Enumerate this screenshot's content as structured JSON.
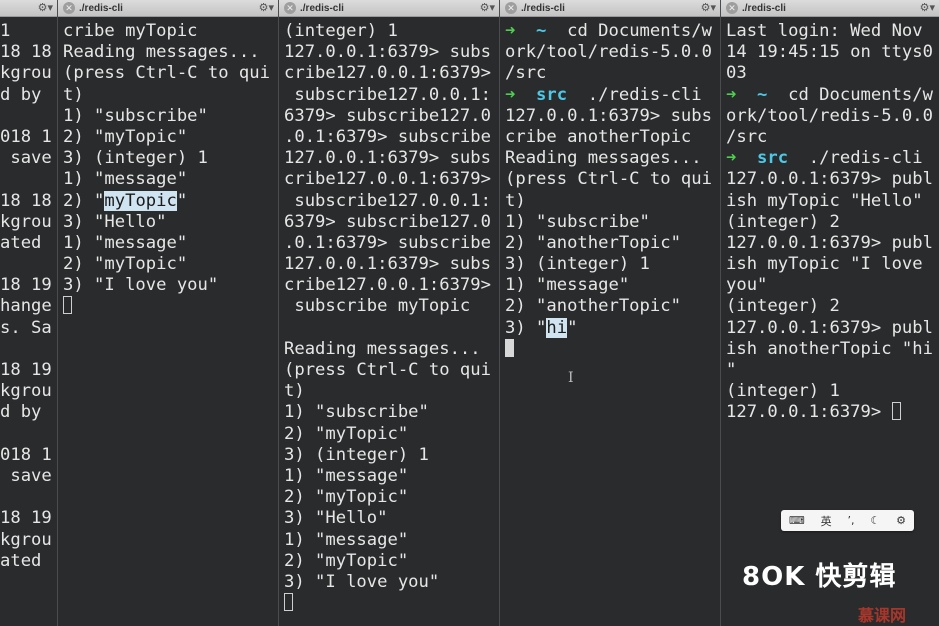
{
  "panes": [
    {
      "title": "",
      "lines": [
        [
          {
            "t": "1"
          }
        ],
        [
          {
            "t": "18 18"
          }
        ],
        [
          {
            "t": "kgrou"
          }
        ],
        [
          {
            "t": "d by"
          }
        ],
        [
          {
            "t": ""
          }
        ],
        [
          {
            "t": "018 1"
          }
        ],
        [
          {
            "t": " save"
          }
        ],
        [
          {
            "t": ""
          }
        ],
        [
          {
            "t": "18 18"
          }
        ],
        [
          {
            "t": "kgrou"
          }
        ],
        [
          {
            "t": "ated"
          }
        ],
        [
          {
            "t": ""
          }
        ],
        [
          {
            "t": "18 19"
          }
        ],
        [
          {
            "t": "hange"
          }
        ],
        [
          {
            "t": "s. Sa"
          }
        ],
        [
          {
            "t": ""
          }
        ],
        [
          {
            "t": "18 19"
          }
        ],
        [
          {
            "t": "kgrou"
          }
        ],
        [
          {
            "t": "d by"
          }
        ],
        [
          {
            "t": ""
          }
        ],
        [
          {
            "t": "018 1"
          }
        ],
        [
          {
            "t": " save"
          }
        ],
        [
          {
            "t": ""
          }
        ],
        [
          {
            "t": "18 19"
          }
        ],
        [
          {
            "t": "kgrou"
          }
        ],
        [
          {
            "t": "ated"
          }
        ]
      ]
    },
    {
      "title": "./redis-cli",
      "lines": [
        [
          {
            "t": "cribe myTopic"
          }
        ],
        [
          {
            "t": "Reading messages..."
          }
        ],
        [
          {
            "t": "(press Ctrl-C to qui"
          }
        ],
        [
          {
            "t": "t)"
          }
        ],
        [
          {
            "t": "1) \"subscribe\""
          }
        ],
        [
          {
            "t": "2) \"myTopic\""
          }
        ],
        [
          {
            "t": "3) (integer) 1"
          }
        ],
        [
          {
            "t": "1) \"message\""
          }
        ],
        [
          {
            "t": "2) \""
          },
          {
            "t": "myTopic",
            "c": "hl"
          },
          {
            "t": "\""
          }
        ],
        [
          {
            "t": "3) \"Hello\""
          }
        ],
        [
          {
            "t": "1) \"message\""
          }
        ],
        [
          {
            "t": "2) \"myTopic\""
          }
        ],
        [
          {
            "t": "3) \"I love you\""
          }
        ],
        [
          {
            "c": "cursor-box"
          }
        ]
      ]
    },
    {
      "title": "./redis-cli",
      "lines": [
        [
          {
            "t": "(integer) 1"
          }
        ],
        [
          {
            "t": "127.0.0.1:6379> subs"
          }
        ],
        [
          {
            "t": "cribe127.0.0.1:6379>"
          }
        ],
        [
          {
            "t": " subscribe127.0.0.1:"
          }
        ],
        [
          {
            "t": "6379> subscribe127.0"
          }
        ],
        [
          {
            "t": ".0.1:6379> subscribe"
          }
        ],
        [
          {
            "t": "127.0.0.1:6379> subs"
          }
        ],
        [
          {
            "t": "cribe127.0.0.1:6379>"
          }
        ],
        [
          {
            "t": " subscribe127.0.0.1:"
          }
        ],
        [
          {
            "t": "6379> subscribe127.0"
          }
        ],
        [
          {
            "t": ".0.1:6379> subscribe"
          }
        ],
        [
          {
            "t": "127.0.0.1:6379> subs"
          }
        ],
        [
          {
            "t": "cribe127.0.0.1:6379>"
          }
        ],
        [
          {
            "t": " subscribe myTopic"
          }
        ],
        [
          {
            "t": ""
          }
        ],
        [
          {
            "t": "Reading messages..."
          }
        ],
        [
          {
            "t": "(press Ctrl-C to qui"
          }
        ],
        [
          {
            "t": "t)"
          }
        ],
        [
          {
            "t": "1) \"subscribe\""
          }
        ],
        [
          {
            "t": "2) \"myTopic\""
          }
        ],
        [
          {
            "t": "3) (integer) 1"
          }
        ],
        [
          {
            "t": "1) \"message\""
          }
        ],
        [
          {
            "t": "2) \"myTopic\""
          }
        ],
        [
          {
            "t": "3) \"Hello\""
          }
        ],
        [
          {
            "t": "1) \"message\""
          }
        ],
        [
          {
            "t": "2) \"myTopic\""
          }
        ],
        [
          {
            "t": "3) \"I love you\""
          }
        ],
        [
          {
            "c": "cursor-box"
          }
        ]
      ]
    },
    {
      "title": "./redis-cli",
      "lines": [
        [
          {
            "t": "➜ ",
            "c": "arrow"
          },
          {
            "t": " ~  ",
            "c": "srcword"
          },
          {
            "t": "cd Documents/w"
          }
        ],
        [
          {
            "t": "ork/tool/redis-5.0.0"
          }
        ],
        [
          {
            "t": "/src"
          }
        ],
        [
          {
            "t": "➜ ",
            "c": "arrow"
          },
          {
            "t": " src  ",
            "c": "srcword"
          },
          {
            "t": "./redis-cli"
          }
        ],
        [
          {
            "t": "127.0.0.1:6379> subs"
          }
        ],
        [
          {
            "t": "cribe anotherTopic"
          }
        ],
        [
          {
            "t": "Reading messages..."
          }
        ],
        [
          {
            "t": "(press Ctrl-C to qui"
          }
        ],
        [
          {
            "t": "t)"
          }
        ],
        [
          {
            "t": "1) \"subscribe\""
          }
        ],
        [
          {
            "t": "2) \"anotherTopic\""
          }
        ],
        [
          {
            "t": "3) (integer) 1"
          }
        ],
        [
          {
            "t": "1) \"message\""
          }
        ],
        [
          {
            "t": "2) \"anotherTopic\""
          }
        ],
        [
          {
            "t": "3) \""
          },
          {
            "t": "hi",
            "c": "hl"
          },
          {
            "t": "\""
          }
        ],
        [
          {
            "c": "cursor-solid"
          }
        ]
      ]
    },
    {
      "title": "./redis-cli",
      "lines": [
        [
          {
            "t": "Last login: Wed Nov"
          }
        ],
        [
          {
            "t": "14 19:45:15 on ttys0"
          }
        ],
        [
          {
            "t": "03"
          }
        ],
        [
          {
            "t": "➜ ",
            "c": "arrow"
          },
          {
            "t": " ~  ",
            "c": "srcword"
          },
          {
            "t": "cd Documents/w"
          }
        ],
        [
          {
            "t": "ork/tool/redis-5.0.0"
          }
        ],
        [
          {
            "t": "/src"
          }
        ],
        [
          {
            "t": "➜ ",
            "c": "arrow"
          },
          {
            "t": " src  ",
            "c": "srcword"
          },
          {
            "t": "./redis-cli"
          }
        ],
        [
          {
            "t": "127.0.0.1:6379> publ"
          }
        ],
        [
          {
            "t": "ish myTopic \"Hello\""
          }
        ],
        [
          {
            "t": "(integer) 2"
          }
        ],
        [
          {
            "t": "127.0.0.1:6379> publ"
          }
        ],
        [
          {
            "t": "ish myTopic \"I love"
          }
        ],
        [
          {
            "t": "you\""
          }
        ],
        [
          {
            "t": "(integer) 2"
          }
        ],
        [
          {
            "t": "127.0.0.1:6379> publ"
          }
        ],
        [
          {
            "t": "ish anotherTopic \"hi"
          }
        ],
        [
          {
            "t": "\""
          }
        ],
        [
          {
            "t": "(integer) 1"
          }
        ],
        [
          {
            "t": "127.0.0.1:6379> "
          },
          {
            "c": "cursor-box"
          }
        ]
      ]
    }
  ],
  "ime": {
    "lang": "英",
    "punct": "’,",
    "moon": "☾",
    "gear": "⚙",
    "kbd": "⌨"
  },
  "watermark": "8OK 快剪辑",
  "watermark2": "慕课网"
}
